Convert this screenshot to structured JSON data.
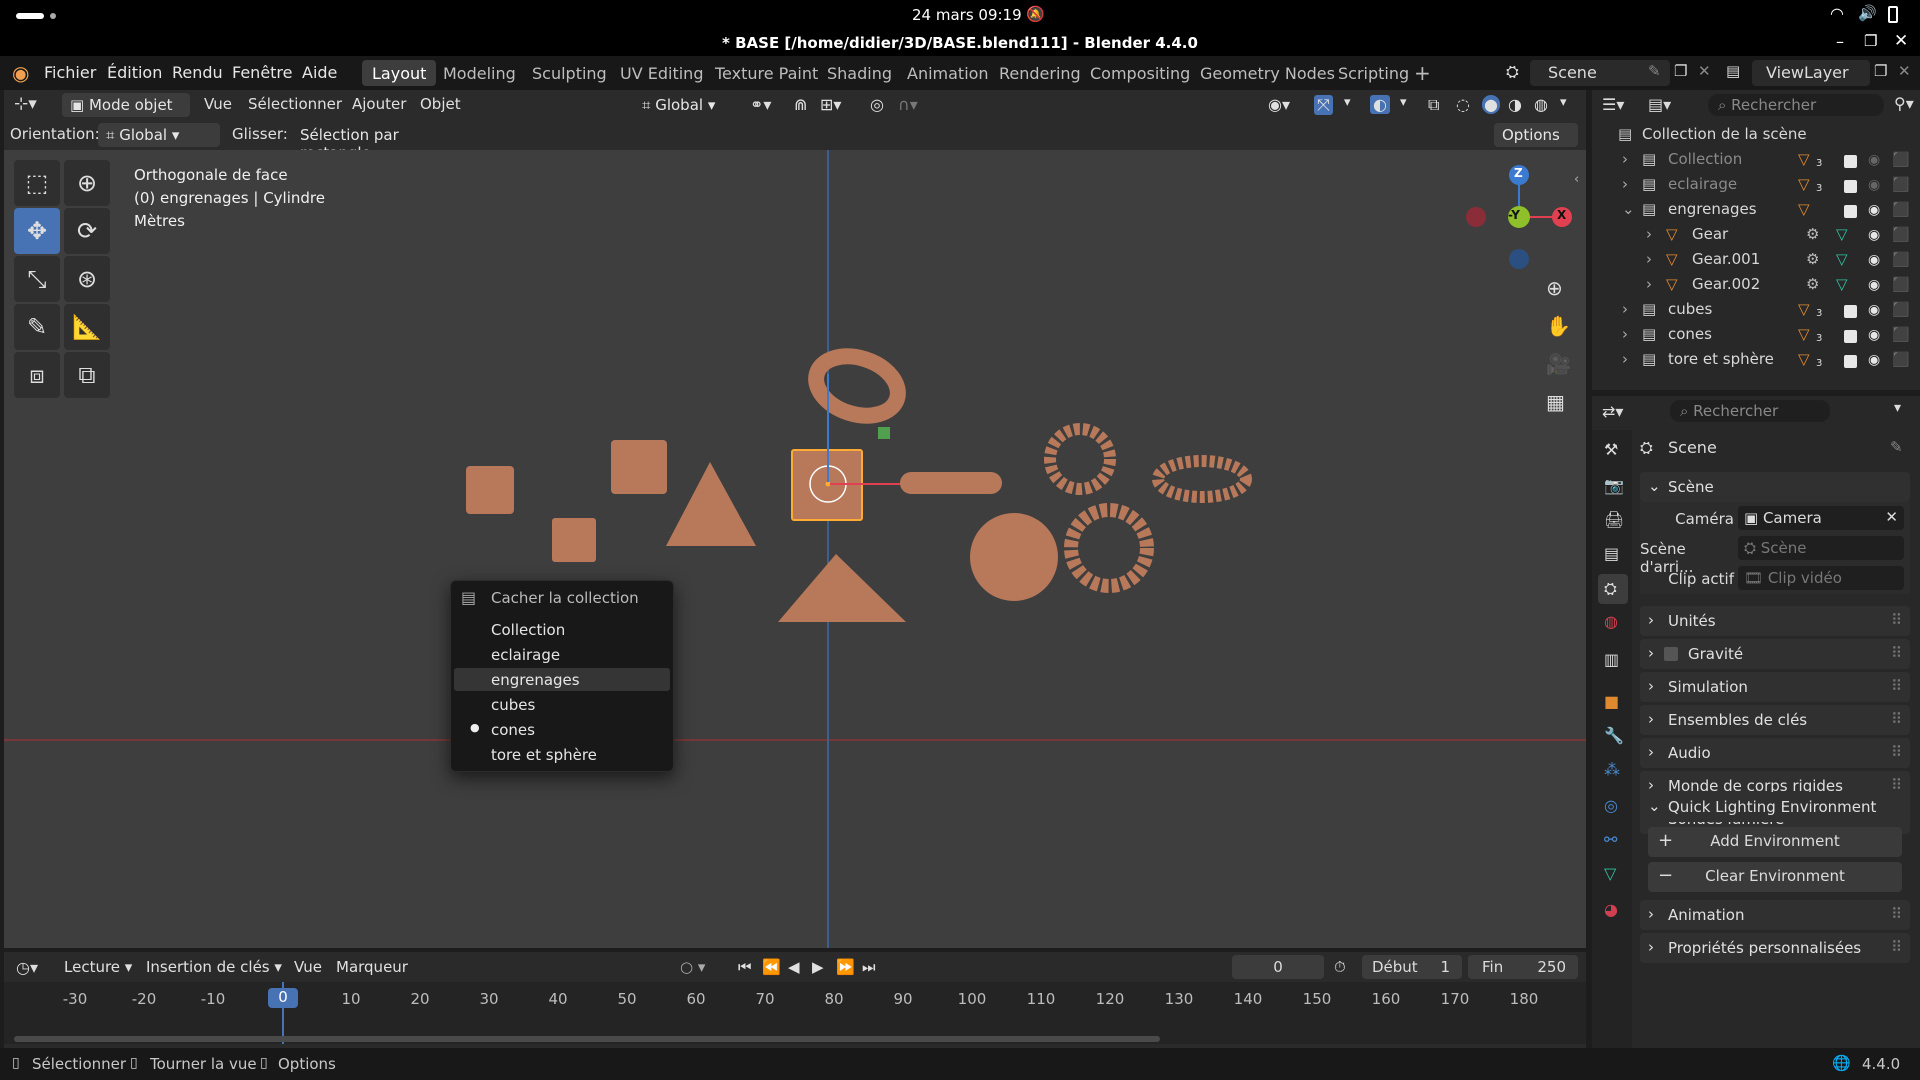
{
  "system_bar": {
    "datetime": "24 mars  09:19"
  },
  "window": {
    "title": "* BASE [/home/didier/3D/BASE.blend111] - Blender 4.4.0"
  },
  "menu": {
    "items": [
      "Fichier",
      "Édition",
      "Rendu",
      "Fenêtre",
      "Aide"
    ]
  },
  "workspaces": {
    "tabs": [
      "Layout",
      "Modeling",
      "Sculpting",
      "UV Editing",
      "Texture Paint",
      "Shading",
      "Animation",
      "Rendering",
      "Compositing",
      "Geometry Nodes",
      "Scripting"
    ],
    "active": "Layout"
  },
  "scene_selector": {
    "scene": "Scene",
    "view_layer": "ViewLayer"
  },
  "viewport_header": {
    "mode": "Mode objet",
    "menus": [
      "Vue",
      "Sélectionner",
      "Ajouter",
      "Objet"
    ],
    "transform": "Global",
    "orientation_label": "Orientation:",
    "orientation_value": "Global",
    "drag_label": "Glisser:",
    "drag_value": "Sélection par rectangle",
    "options": "Options"
  },
  "viewport_overlay": {
    "line1": "Orthogonale de face",
    "line2": "(0) engrenages | Cylindre",
    "line3": "Mètres"
  },
  "gizmo": {
    "z": "Z",
    "y": "-Y",
    "x": "X"
  },
  "context_menu": {
    "title": "Cacher la collection",
    "items": [
      "Collection",
      "eclairage",
      "engrenages",
      "cubes",
      "cones",
      "tore et sphère"
    ],
    "highlighted": "engrenages",
    "marked": "cones"
  },
  "outliner": {
    "search_placeholder": "Rechercher",
    "root": "Collection de la scène",
    "rows": [
      {
        "label": "Collection",
        "level": 0,
        "count": "3"
      },
      {
        "label": "eclairage",
        "level": 0,
        "count": "3"
      },
      {
        "label": "engrenages",
        "level": 0,
        "count": ""
      },
      {
        "label": "Gear",
        "level": 1,
        "count": ""
      },
      {
        "label": "Gear.001",
        "level": 1,
        "count": ""
      },
      {
        "label": "Gear.002",
        "level": 1,
        "count": ""
      },
      {
        "label": "cubes",
        "level": 0,
        "count": "3"
      },
      {
        "label": "cones",
        "level": 0,
        "count": "3"
      },
      {
        "label": "tore et sphère",
        "level": 0,
        "count": "3"
      }
    ]
  },
  "properties": {
    "search_placeholder": "Rechercher",
    "title": "Scene",
    "scene_section": "Scène",
    "camera_label": "Caméra",
    "camera_value": "Camera",
    "background_label": "Scène d'arri...",
    "background_placeholder": "Scène",
    "clip_label": "Clip actif",
    "clip_placeholder": "Clip vidéo",
    "sections": [
      "Unités",
      "Gravité",
      "Simulation",
      "Ensembles de clés",
      "Audio",
      "Monde de corps rigides",
      "Sondes lumière"
    ],
    "quick_lighting": "Quick Lighting Environment",
    "add_env": "Add Environment",
    "clear_env": "Clear Environment",
    "sections_after": [
      "Animation",
      "Propriétés personnalisées"
    ]
  },
  "timeline": {
    "menus": [
      "Lecture",
      "Insertion de clés",
      "Vue",
      "Marqueur"
    ],
    "current_frame": "0",
    "start_label": "Début",
    "start_value": "1",
    "end_label": "Fin",
    "end_value": "250",
    "ticks": [
      "-30",
      "-20",
      "-10",
      "0",
      "10",
      "20",
      "30",
      "40",
      "50",
      "60",
      "70",
      "80",
      "90",
      "100",
      "110",
      "120",
      "130",
      "140",
      "150",
      "160",
      "170",
      "180"
    ],
    "playhead": "0"
  },
  "status_bar": {
    "select": "Sélectionner",
    "rotate": "Tourner la vue",
    "options": "Options",
    "version": "4.4.0"
  },
  "colors": {
    "accent": "#4772b3",
    "object": "#b8785a",
    "selected": "#ffaa33",
    "axis_red": "#e04050",
    "axis_green": "#8fc02a",
    "axis_blue": "#3a7ad0"
  }
}
